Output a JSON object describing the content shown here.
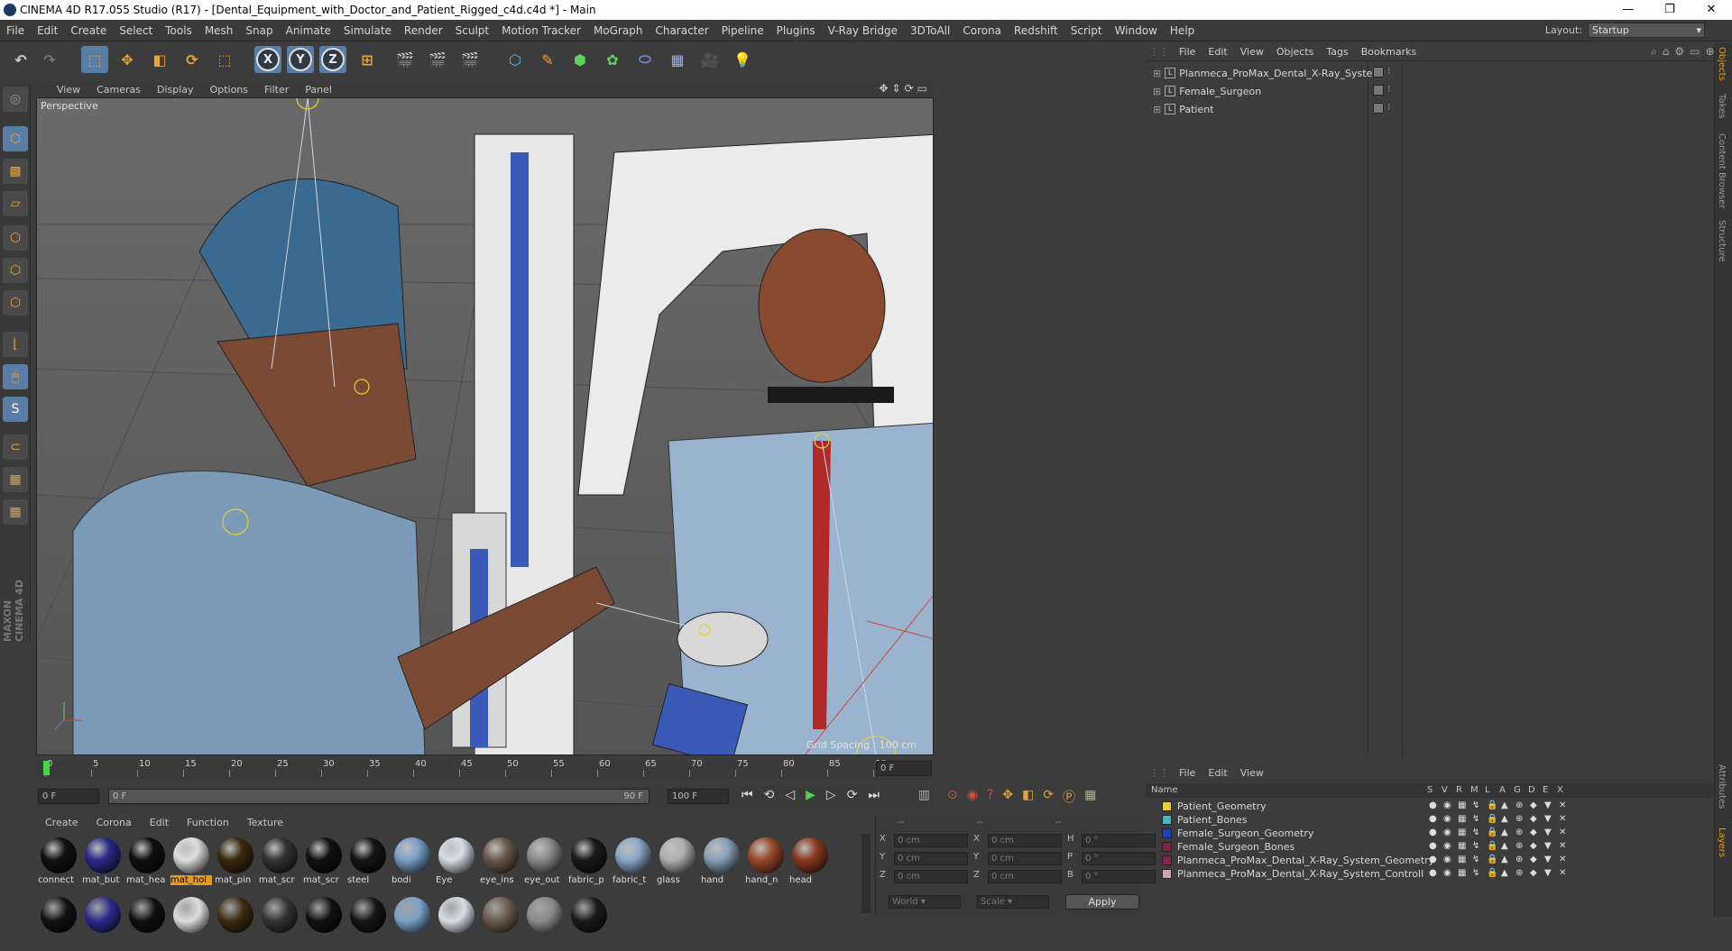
{
  "window": {
    "title": "CINEMA 4D R17.055 Studio (R17) - [Dental_Equipment_with_Doctor_and_Patient_Rigged_c4d.c4d *] - Main",
    "minimize": "—",
    "maximize": "❐",
    "close": "✕"
  },
  "menu": [
    "File",
    "Edit",
    "Create",
    "Select",
    "Tools",
    "Mesh",
    "Snap",
    "Animate",
    "Simulate",
    "Render",
    "Sculpt",
    "Motion Tracker",
    "MoGraph",
    "Character",
    "Pipeline",
    "Plugins",
    "V-Ray Bridge",
    "3DToAll",
    "Corona",
    "Redshift",
    "Script",
    "Window",
    "Help"
  ],
  "layout": {
    "label": "Layout:",
    "value": "Startup"
  },
  "toolbar": {
    "x": "X",
    "y": "Y",
    "z": "Z"
  },
  "viewport_menu": [
    "View",
    "Cameras",
    "Display",
    "Options",
    "Filter",
    "Panel"
  ],
  "viewport": {
    "label": "Perspective",
    "grid_spacing": "Grid Spacing : 100 cm"
  },
  "timeline": {
    "ticks": [
      "0",
      "5",
      "10",
      "15",
      "20",
      "25",
      "30",
      "35",
      "40",
      "45",
      "50",
      "55",
      "60",
      "65",
      "70",
      "75",
      "80",
      "85",
      "90"
    ],
    "current_frame": "0 F",
    "start": "0 F",
    "range_start": "0 F",
    "range_end": "90 F",
    "end": "100 F"
  },
  "material_menu": [
    "Create",
    "Corona",
    "Edit",
    "Function",
    "Texture"
  ],
  "materials": [
    {
      "name": "connect",
      "color": "#111111"
    },
    {
      "name": "mat_but",
      "color": "#2a2a8a"
    },
    {
      "name": "mat_hea",
      "color": "#101010"
    },
    {
      "name": "mat_hol",
      "color": "#dddddd",
      "active": true
    },
    {
      "name": "mat_pin",
      "color": "#3a2a10"
    },
    {
      "name": "mat_scr",
      "color": "#333333"
    },
    {
      "name": "mat_scr",
      "color": "#111111"
    },
    {
      "name": "steel",
      "color": "#151515"
    },
    {
      "name": "bodi",
      "color": "#7aa0c8"
    },
    {
      "name": "Eye",
      "color": "#d8dde6"
    },
    {
      "name": "eye_ins",
      "color": "#6a5a4a"
    },
    {
      "name": "eye_out",
      "color": "#8a8a8a"
    },
    {
      "name": "fabric_p",
      "color": "#1a1a1a"
    },
    {
      "name": "fabric_t",
      "color": "#8aa8c8"
    },
    {
      "name": "glass",
      "color": "#b0b0b0"
    },
    {
      "name": "hand",
      "color": "#8aa0b8"
    },
    {
      "name": "hand_n",
      "color": "#9a4a2a"
    },
    {
      "name": "head",
      "color": "#8a3a20"
    }
  ],
  "coords": {
    "headers": [
      "--",
      "--",
      "--"
    ],
    "rows": [
      {
        "a": "X",
        "av": "0 cm",
        "b": "X",
        "bv": "0 cm",
        "c": "H",
        "cv": "0 °"
      },
      {
        "a": "Y",
        "av": "0 cm",
        "b": "Y",
        "bv": "0 cm",
        "c": "P",
        "cv": "0 °"
      },
      {
        "a": "Z",
        "av": "0 cm",
        "b": "Z",
        "bv": "0 cm",
        "c": "B",
        "cv": "0 °"
      }
    ],
    "world": "World",
    "scale": "Scale",
    "apply": "Apply"
  },
  "object_menu": [
    "File",
    "Edit",
    "View",
    "Objects",
    "Tags",
    "Bookmarks"
  ],
  "objects": [
    "Planmeca_ProMax_Dental_X-Ray_System",
    "Female_Surgeon",
    "Patient"
  ],
  "layer_menu": [
    "File",
    "Edit",
    "View"
  ],
  "layer_header": {
    "name": "Name",
    "cols": [
      "S",
      "V",
      "R",
      "M",
      "L",
      "A",
      "G",
      "D",
      "E",
      "X"
    ]
  },
  "layers": [
    {
      "name": "Patient_Geometry",
      "color": "#e8d020"
    },
    {
      "name": "Patient_Bones",
      "color": "#30c0d0"
    },
    {
      "name": "Female_Surgeon_Geometry",
      "color": "#2040c0"
    },
    {
      "name": "Female_Surgeon_Bones",
      "color": "#8a2040"
    },
    {
      "name": "Planmeca_ProMax_Dental_X-Ray_System_Geometry",
      "color": "#8a2050"
    },
    {
      "name": "Planmeca_ProMax_Dental_X-Ray_System_Controll",
      "color": "#d8a0b8"
    }
  ],
  "right_tabs": [
    {
      "label": "Objects",
      "on": true
    },
    {
      "label": "Takes",
      "on": false
    },
    {
      "label": "Content Browser",
      "on": false
    },
    {
      "label": "Structure",
      "on": false
    },
    {
      "label": "Attributes",
      "on": false
    },
    {
      "label": "Layers",
      "on": true
    }
  ],
  "maxon_logo": "MAXON CINEMA 4D"
}
